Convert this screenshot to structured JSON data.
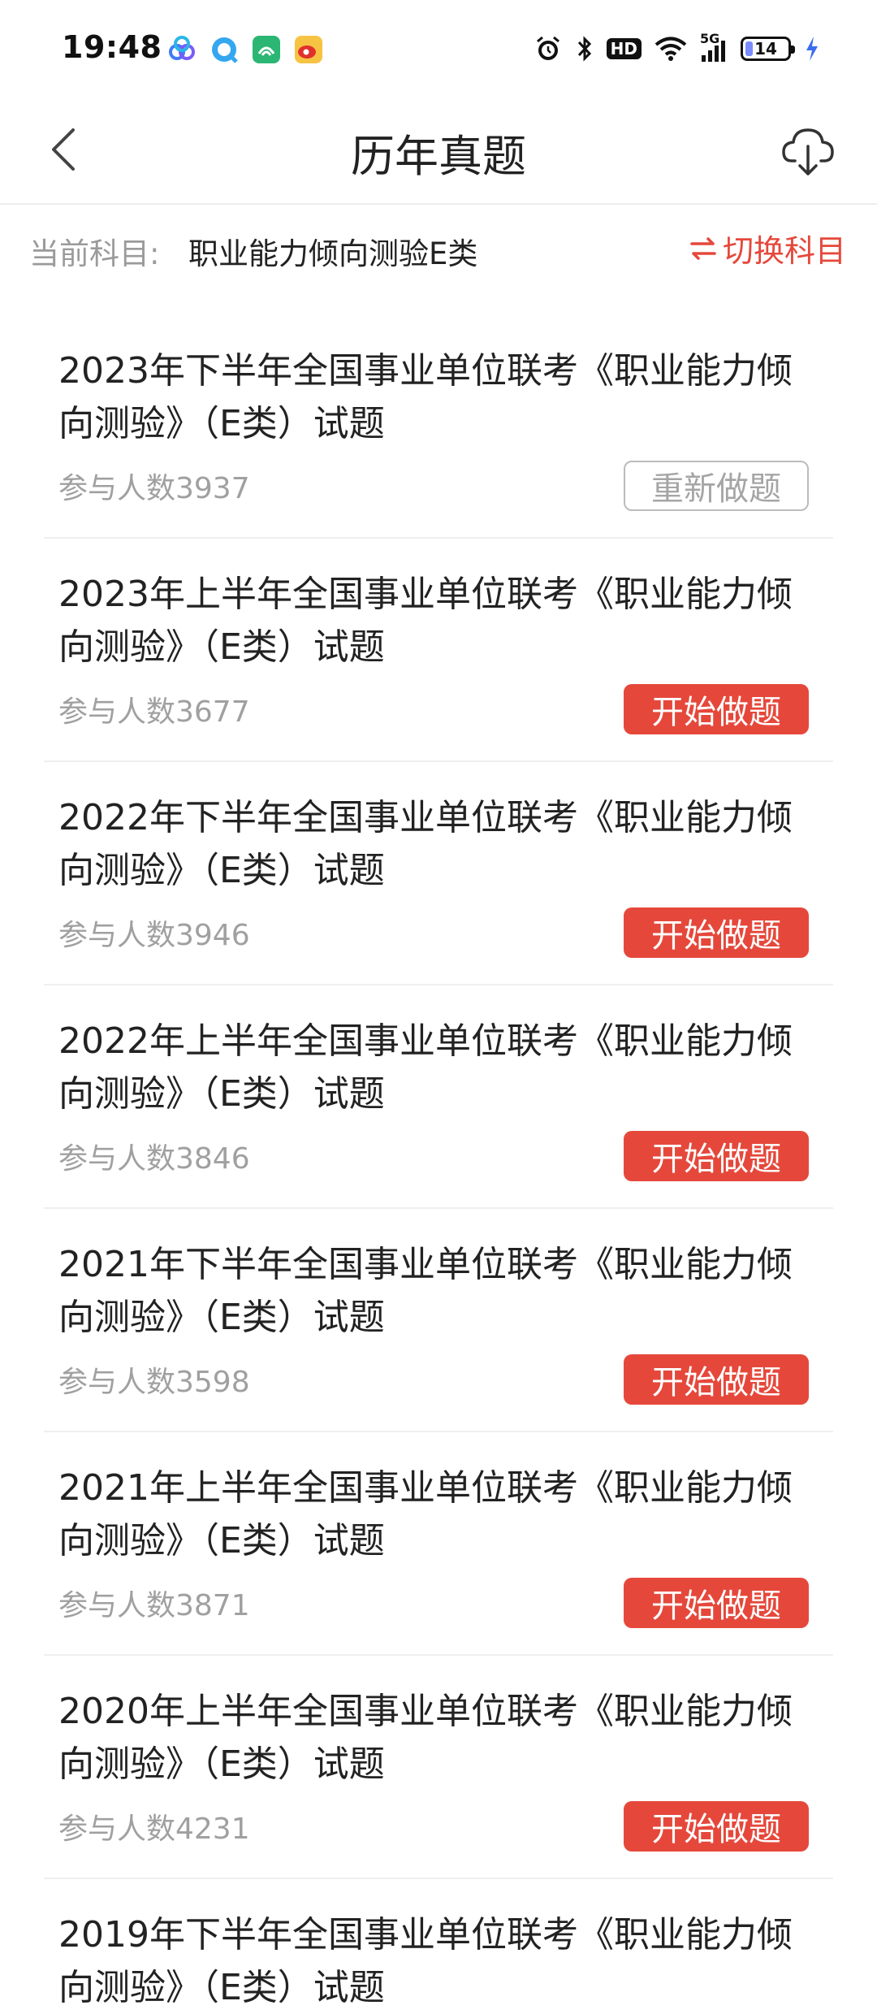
{
  "status_bar": {
    "time": "19:48",
    "network": "5G",
    "hd_label": "HD",
    "battery": "14",
    "app_icons": [
      {
        "name": "cloud-app-icon",
        "color": "#3f7cf6"
      },
      {
        "name": "browser-app-icon",
        "color": "#34a7f0"
      },
      {
        "name": "id-card-app-icon",
        "color": "#2bb673"
      },
      {
        "name": "weibo-app-icon",
        "color": "#f3a21b"
      }
    ]
  },
  "nav": {
    "title": "历年真题"
  },
  "subject": {
    "label": "当前科目:",
    "value": "职业能力倾向测验E类",
    "switch_label": "切换科目"
  },
  "papers": [
    {
      "title": "2023年下半年全国事业单位联考《职业能力倾向测验》（E类）试题",
      "count": "参与人数3937",
      "button": "重新做题",
      "state": "done"
    },
    {
      "title": "2023年上半年全国事业单位联考《职业能力倾向测验》（E类）试题",
      "count": "参与人数3677",
      "button": "开始做题",
      "state": "start"
    },
    {
      "title": "2022年下半年全国事业单位联考《职业能力倾向测验》（E类）试题",
      "count": "参与人数3946",
      "button": "开始做题",
      "state": "start"
    },
    {
      "title": "2022年上半年全国事业单位联考《职业能力倾向测验》（E类）试题",
      "count": "参与人数3846",
      "button": "开始做题",
      "state": "start"
    },
    {
      "title": "2021年下半年全国事业单位联考《职业能力倾向测验》（E类）试题",
      "count": "参与人数3598",
      "button": "开始做题",
      "state": "start"
    },
    {
      "title": "2021年上半年全国事业单位联考《职业能力倾向测验》（E类）试题",
      "count": "参与人数3871",
      "button": "开始做题",
      "state": "start"
    },
    {
      "title": "2020年上半年全国事业单位联考《职业能力倾向测验》（E类）试题",
      "count": "参与人数4231",
      "button": "开始做题",
      "state": "start"
    },
    {
      "title": "2019年下半年全国事业单位联考《职业能力倾向测验》（E类）试题"
    }
  ],
  "colors": {
    "accent": "#e5483b",
    "muted_text": "#a0a0a0",
    "divider": "#efefef"
  }
}
